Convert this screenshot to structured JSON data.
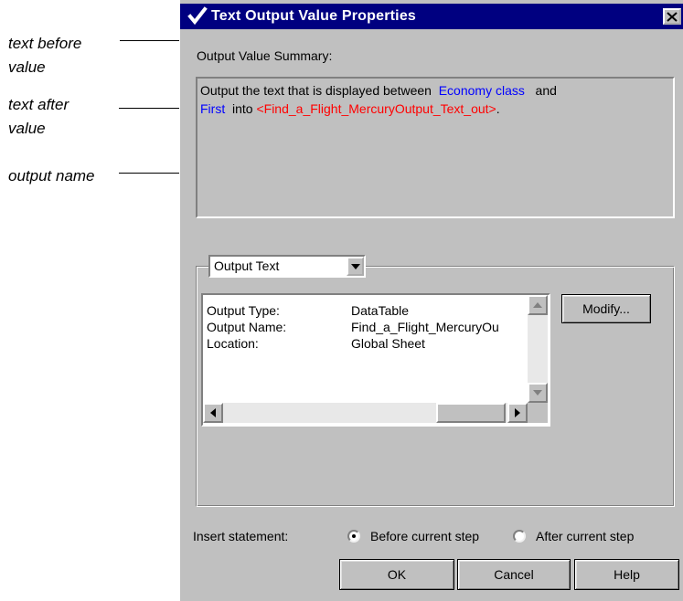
{
  "annotations": {
    "text_before": "text before\nvalue",
    "text_after": "text after\nvalue",
    "output_name": "output name"
  },
  "dialog": {
    "title": "Text Output Value Properties",
    "summary_label": "Output Value Summary:",
    "summary": {
      "prefix": "Output the text that is displayed between",
      "before_value": "Economy class",
      "joiner": "and",
      "after_value": "First",
      "into": "into",
      "output_name": "<Find_a_Flight_MercuryOutput_Text_out>",
      "suffix": "."
    },
    "output_combo": {
      "selected": "Output Text"
    },
    "details": [
      {
        "key": "Output Type:",
        "value": "DataTable"
      },
      {
        "key": "Output Name:",
        "value": "Find_a_Flight_MercuryOu"
      },
      {
        "key": "Location:",
        "value": "Global Sheet"
      }
    ],
    "modify_label": "Modify...",
    "insert_label": "Insert statement:",
    "radio_before": {
      "label": "Before current step",
      "checked": true
    },
    "radio_after": {
      "label": "After current step",
      "checked": false
    },
    "buttons": {
      "ok": "OK",
      "cancel": "Cancel",
      "help": "Help"
    }
  },
  "colors": {
    "titlebar": "#000080",
    "dialog_bg": "#c0c0c0",
    "value_highlight": "#0000ff",
    "output_name_highlight": "#ff0000"
  },
  "icons": {
    "title": "checkmark-icon",
    "close": "close-icon",
    "dropdown": "chevron-down-icon",
    "scroll_up": "arrow-up-icon",
    "scroll_down": "arrow-down-icon",
    "scroll_left": "arrow-left-icon",
    "scroll_right": "arrow-right-icon"
  }
}
